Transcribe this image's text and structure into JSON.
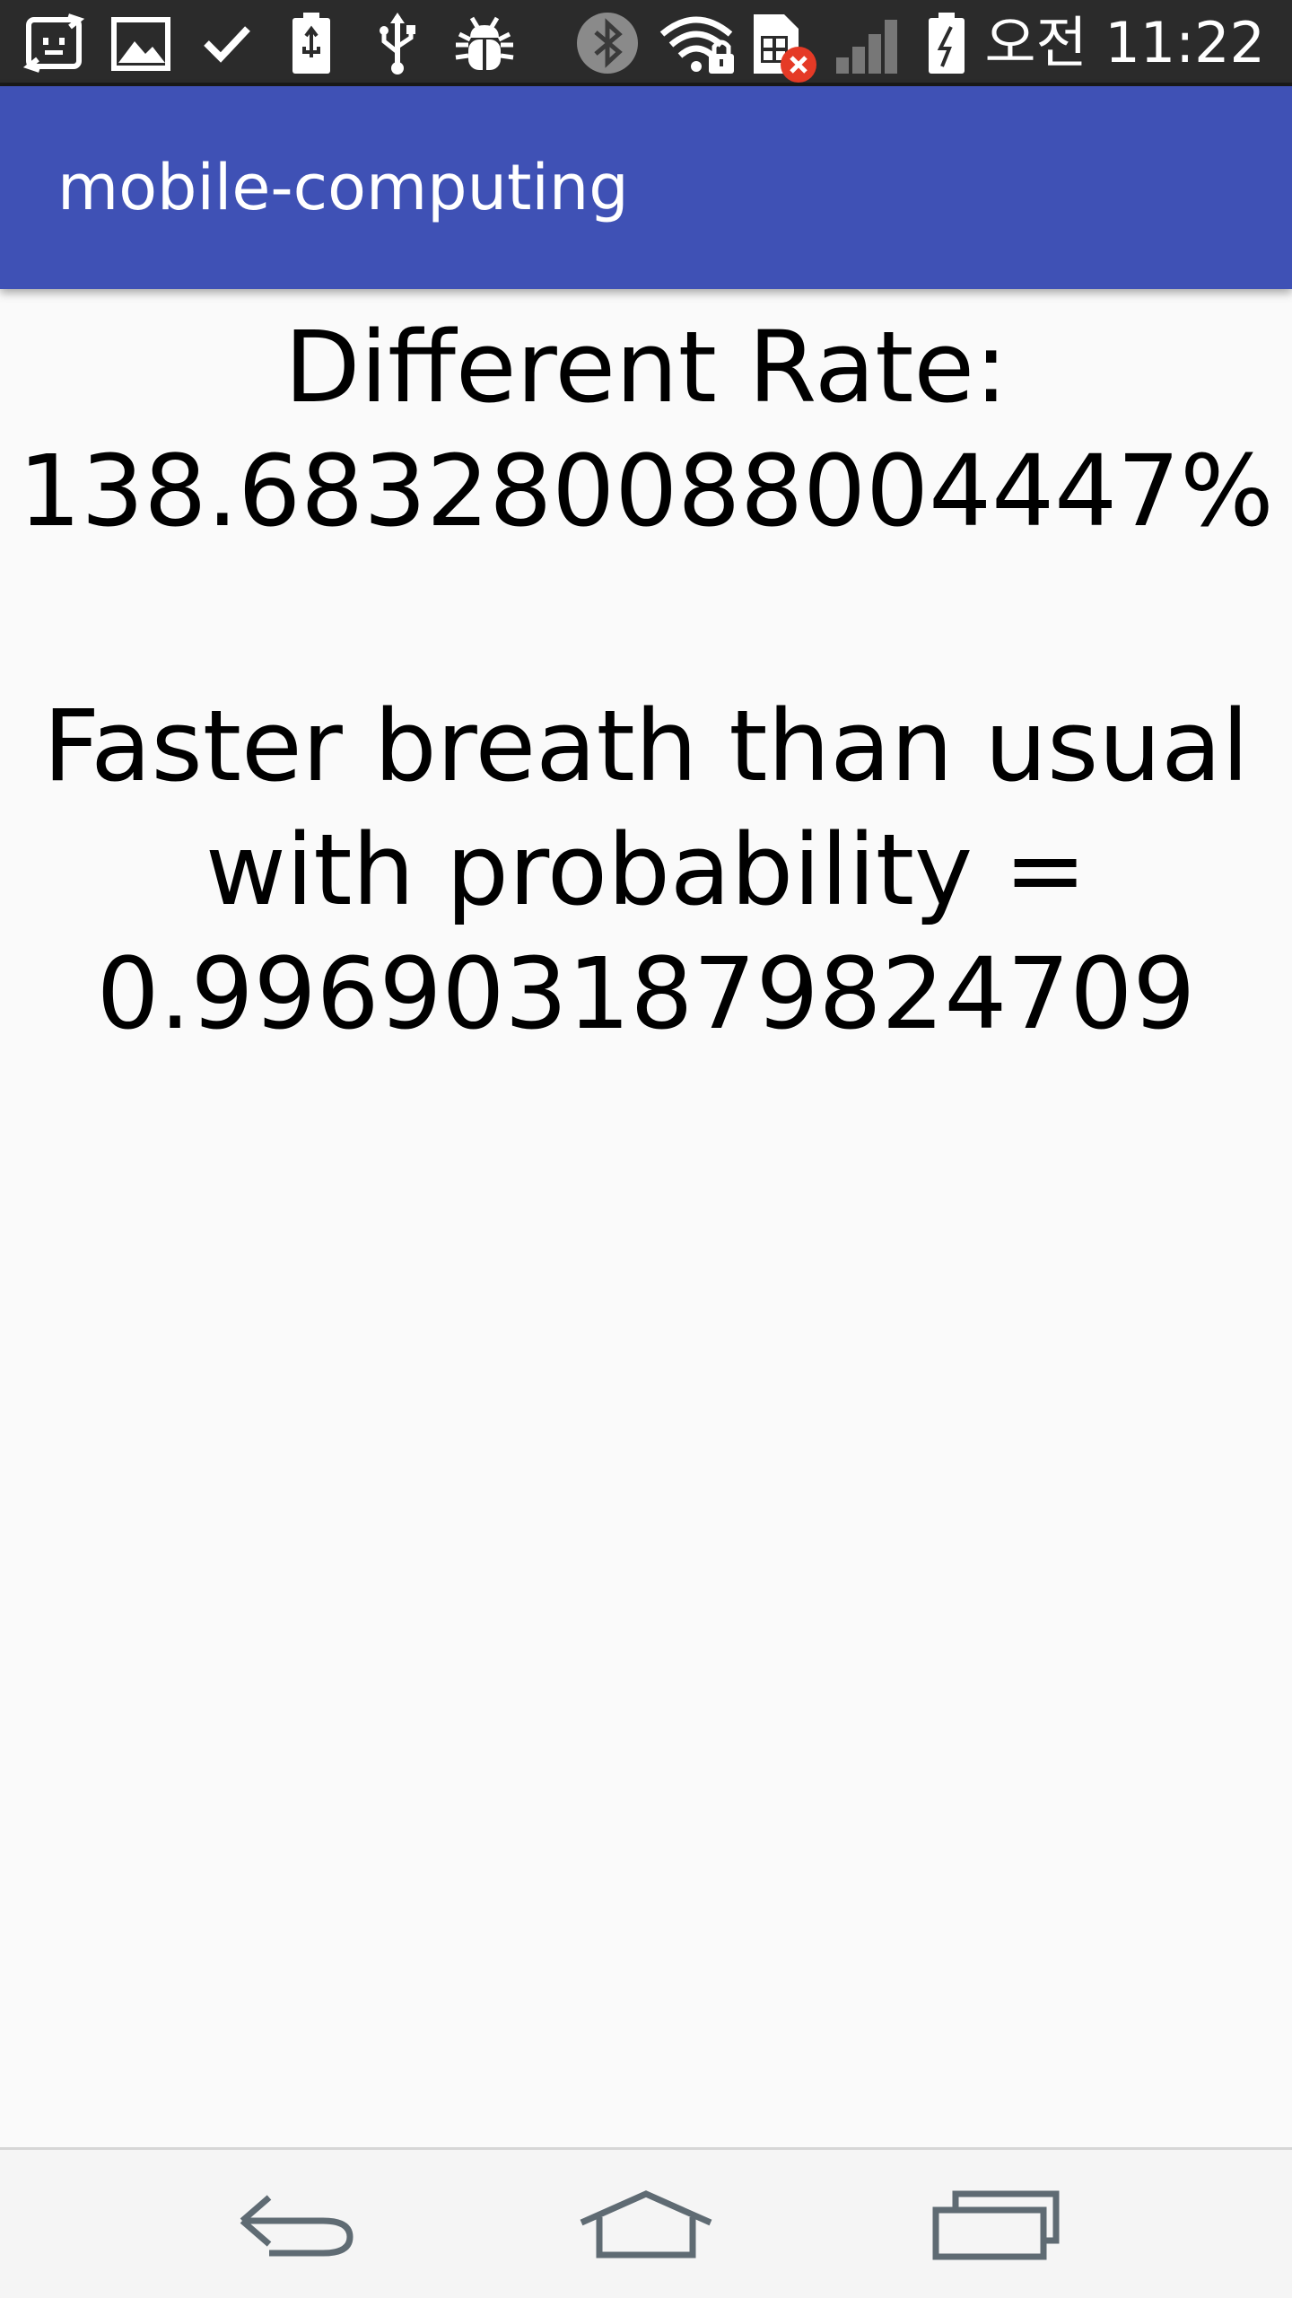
{
  "status_bar": {
    "time": "오전 11:22",
    "icons": [
      "sync-notification-icon",
      "image-icon",
      "check-icon",
      "battery-charging-icon",
      "usb-icon",
      "debug-bug-icon",
      "bluetooth-icon",
      "wifi-locked-icon",
      "sim-error-icon",
      "cell-signal-icon",
      "battery-icon"
    ],
    "colors": {
      "background": "#2b2b2b",
      "icon": "#ffffff",
      "bluetooth": "#8a8a8a",
      "sim_error": "#e53a26"
    }
  },
  "app_bar": {
    "title": "mobile-computing",
    "color": "#3f51b5"
  },
  "content": {
    "rate_lines": [
      "Different Rate:",
      "138.683280088004447%"
    ],
    "probability_lines": [
      "Faster breath than usual",
      "with probability =",
      "0.9969031879824709"
    ]
  },
  "nav_bar": {
    "buttons": [
      "back-icon",
      "home-icon",
      "recents-icon"
    ],
    "icon_color": "#5f6b73"
  }
}
